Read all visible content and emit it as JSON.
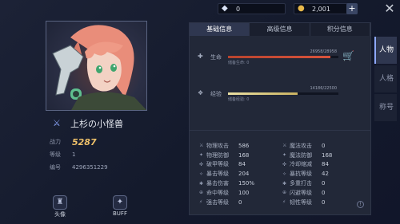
{
  "resources": {
    "gem_icon": "diamond-icon",
    "gems": "0",
    "gold_icon": "coin-icon",
    "gold": "2,001",
    "add_label": "+"
  },
  "close_label": "✕",
  "character": {
    "name": "上杉の小怪兽",
    "info": [
      {
        "label": "战力",
        "value": "5287"
      },
      {
        "label": "等级",
        "value": "1"
      },
      {
        "label": "编号",
        "value": "4296351229"
      }
    ]
  },
  "bottom_buttons": {
    "portrait_label": "头像",
    "buff_label": "BUFF"
  },
  "tabs": [
    "基础信息",
    "高级信息",
    "积分信息"
  ],
  "active_tab": 0,
  "hp": {
    "label": "生命",
    "value": "26958/28958",
    "percent": 0.93,
    "sub": "储备生命: 0"
  },
  "xp": {
    "label": "经验",
    "value": "14186/22500",
    "percent": 0.63,
    "sub": "储备经验: 0"
  },
  "stats": [
    [
      {
        "label": "物理攻击",
        "value": "586"
      },
      {
        "label": "魔法攻击",
        "value": "0"
      }
    ],
    [
      {
        "label": "物理防御",
        "value": "168"
      },
      {
        "label": "魔法防御",
        "value": "168"
      }
    ],
    [
      {
        "label": "破甲等级",
        "value": "84"
      },
      {
        "label": "冷却缩减",
        "value": "84"
      }
    ],
    [
      {
        "label": "暴击等级",
        "value": "204"
      },
      {
        "label": "暴抗等级",
        "value": "42"
      }
    ],
    [
      {
        "label": "暴击伤害",
        "value": "150%"
      },
      {
        "label": "多重打击",
        "value": "0"
      }
    ],
    [
      {
        "label": "命中等级",
        "value": "100"
      },
      {
        "label": "闪避等级",
        "value": "0"
      }
    ],
    [
      {
        "label": "强击等级",
        "value": "0"
      },
      {
        "label": "韧性等级",
        "value": "0"
      }
    ]
  ],
  "side_tabs": [
    "人物",
    "人格",
    "称号"
  ],
  "active_side_tab": 0,
  "colors": {
    "hp_bar": "#d9533c",
    "xp_bar": "#e9dfa2",
    "power_text": "#f0c26a",
    "accent": "#8ea8ff"
  }
}
